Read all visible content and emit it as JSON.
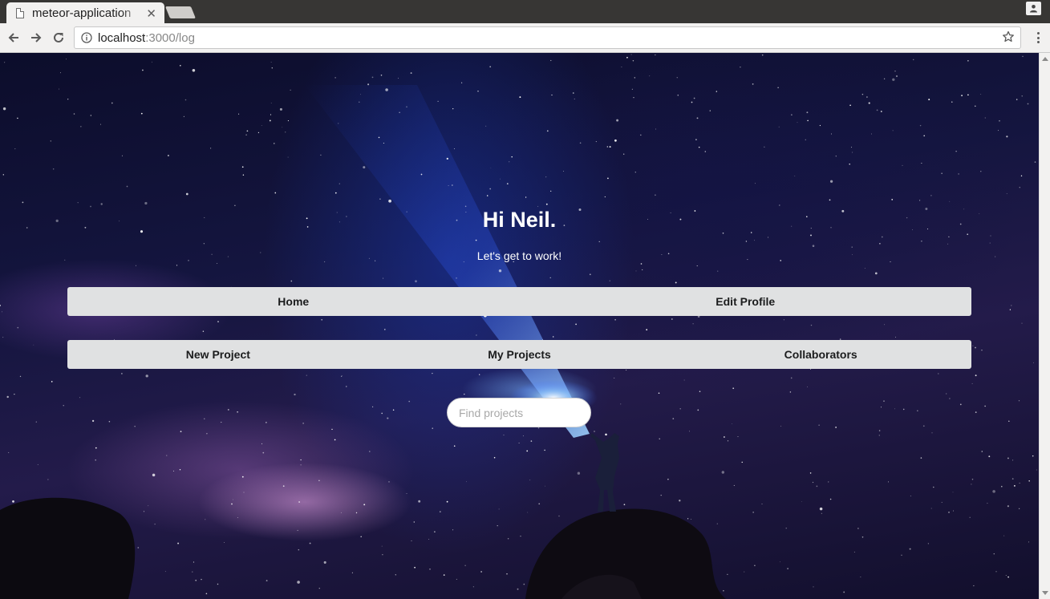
{
  "browser": {
    "tab_title": "meteor-application",
    "url_host": "localhost",
    "url_path": ":3000/log"
  },
  "page": {
    "greeting": "Hi Neil.",
    "subtitle": "Let's get to work!",
    "primary_nav": [
      {
        "label": "Home"
      },
      {
        "label": "Edit Profile"
      }
    ],
    "project_nav": [
      {
        "label": "New Project"
      },
      {
        "label": "My Projects"
      },
      {
        "label": "Collaborators"
      }
    ],
    "search": {
      "placeholder": "Find projects",
      "value": ""
    }
  },
  "colors": {
    "menu_background": "#e0e1e2",
    "menu_text": "#1b1c1d",
    "heading_text": "#ffffff"
  }
}
